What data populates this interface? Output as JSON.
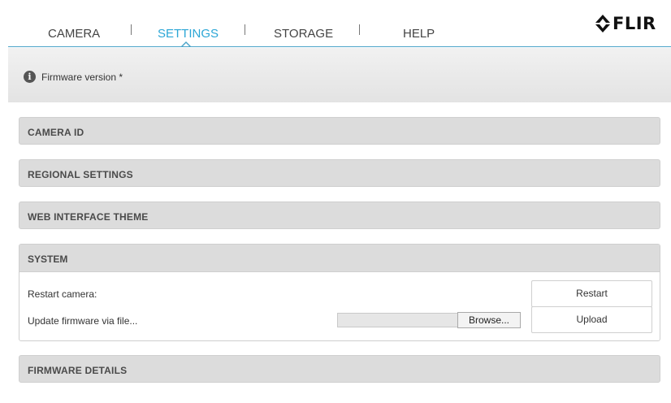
{
  "nav": {
    "tabs": [
      {
        "label": "CAMERA"
      },
      {
        "label": "SETTINGS",
        "active": true
      },
      {
        "label": "STORAGE"
      },
      {
        "label": "HELP"
      }
    ],
    "active_color": "#2ba6d6"
  },
  "logo": {
    "text": "FLIR"
  },
  "info": {
    "icon": "info-icon",
    "glyph": "i",
    "text": "Firmware version *"
  },
  "sections": {
    "camera_id": "CAMERA ID",
    "regional_settings": "REGIONAL SETTINGS",
    "web_interface_theme": "WEB INTERFACE THEME",
    "system": {
      "title": "SYSTEM",
      "restart_label": "Restart camera:",
      "restart_button": "Restart",
      "update_label": "Update firmware via file...",
      "browse_button": "Browse...",
      "upload_button": "Upload"
    },
    "firmware_details": "FIRMWARE DETAILS"
  }
}
